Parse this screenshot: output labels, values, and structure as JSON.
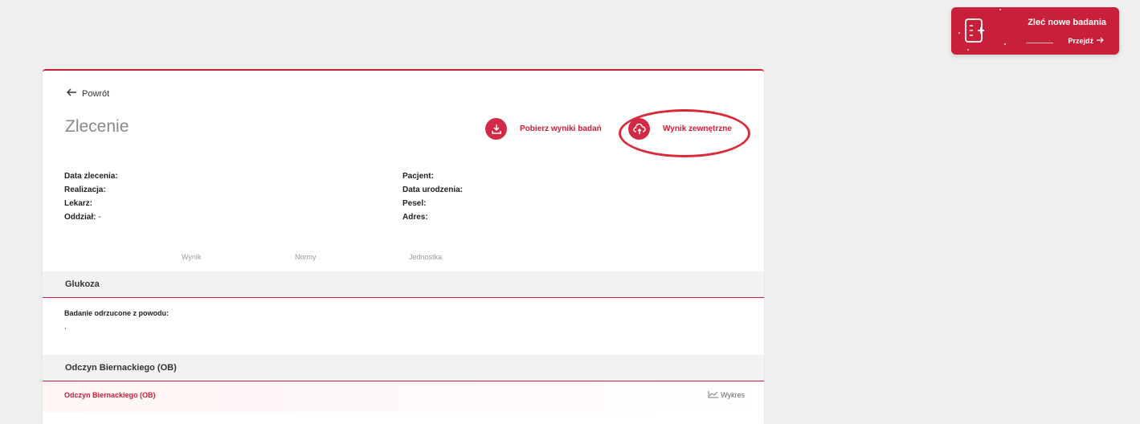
{
  "promo": {
    "title": "Zleć nowe badania",
    "go_label": "Przejdź",
    "icon": "document-plus-icon"
  },
  "nav": {
    "back_label": "Powrót"
  },
  "page": {
    "title": "Zlecenie"
  },
  "actions": {
    "download_label": "Pobierz wyniki badań",
    "download_icon": "download-icon",
    "external_label": "Wynik zewnętrzne",
    "external_icon": "cloud-icon"
  },
  "order_info": {
    "left": [
      {
        "label": "Data zlecenia:",
        "value": ""
      },
      {
        "label": "Realizacja:",
        "value": ""
      },
      {
        "label": "Lekarz:",
        "value": ""
      },
      {
        "label": "Oddział:",
        "value": " -"
      }
    ],
    "right": [
      {
        "label": "Pacjent:",
        "value": ""
      },
      {
        "label": "Data urodzenia:",
        "value": ""
      },
      {
        "label": "Pesel:",
        "value": ""
      },
      {
        "label": "Adres:",
        "value": ""
      }
    ]
  },
  "results_table": {
    "columns": [
      "Wynik",
      "Normy",
      "Jednostka"
    ],
    "sections": [
      {
        "name": "Glukoza",
        "rejected_label": "Badanie odrzucone z powodu:",
        "rejected_value": ","
      },
      {
        "name": "Odczyn Biernackiego (OB)",
        "rows": [
          {
            "name": "Odczyn Biernackiego (OB)",
            "chart_label": "Wykres"
          }
        ]
      }
    ]
  },
  "colors": {
    "accent": "#c8203a",
    "background": "#efefef",
    "highlight": "#d82a37"
  }
}
